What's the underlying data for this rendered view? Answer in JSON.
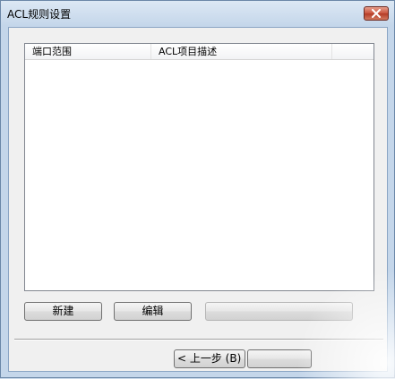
{
  "window": {
    "title": "ACL规则设置"
  },
  "list": {
    "columns": [
      "端口范围",
      "ACL项目描述",
      ""
    ]
  },
  "buttons": {
    "new_label": "新建",
    "edit_label": "编辑",
    "delete_label": "",
    "back_label": "< 上一步 (B)",
    "next_label": ""
  },
  "colors": {
    "titlebar": "#c4d6ea",
    "close_button": "#c8523b",
    "client_bg": "#f0f0f0"
  }
}
